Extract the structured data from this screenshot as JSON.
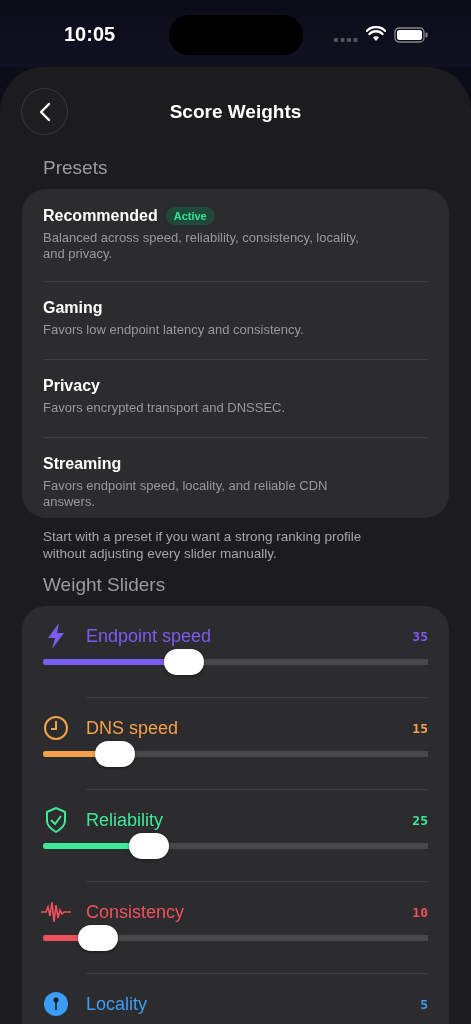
{
  "status_bar": {
    "time": "10:05"
  },
  "header": {
    "title": "Score Weights"
  },
  "presets": {
    "heading": "Presets",
    "items": [
      {
        "name": "Recommended",
        "badge": "Active",
        "description": "Balanced across speed, reliability, consistency, locality, and privacy."
      },
      {
        "name": "Gaming",
        "description": "Favors low endpoint latency and consistency."
      },
      {
        "name": "Privacy",
        "description": "Favors encrypted transport and DNSSEC."
      },
      {
        "name": "Streaming",
        "description": "Favors endpoint speed, locality, and reliable CDN answers."
      }
    ],
    "note": "Start with a preset if you want a strong ranking profile without adjusting every slider manually."
  },
  "weights": {
    "heading": "Weight Sliders",
    "sliders": [
      {
        "kind": "bolt",
        "label": "Endpoint speed",
        "value": "35",
        "color": "#7b5cf0",
        "level": 0.35
      },
      {
        "kind": "clock",
        "label": "DNS speed",
        "value": "15",
        "color": "#f5a04a",
        "level": 0.15
      },
      {
        "kind": "shield",
        "label": "Reliability",
        "value": "25",
        "color": "#3ee89a",
        "level": 0.25
      },
      {
        "kind": "wave",
        "label": "Consistency",
        "value": "10",
        "color": "#f0505e",
        "level": 0.1
      },
      {
        "kind": "pin",
        "label": "Locality",
        "value": "5",
        "color": "#3b9cf5"
      }
    ]
  }
}
